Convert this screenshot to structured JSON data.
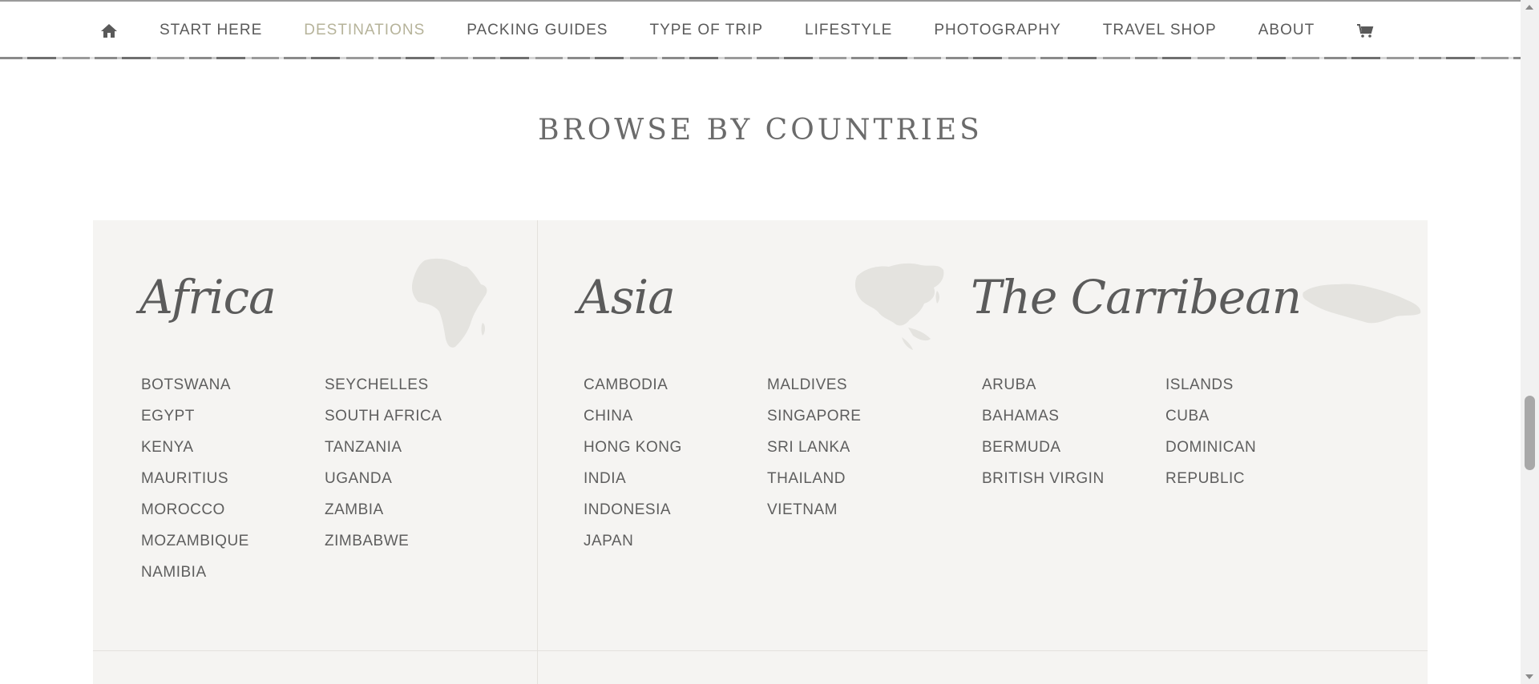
{
  "nav": {
    "items": [
      {
        "label": "START HERE"
      },
      {
        "label": "DESTINATIONS",
        "active": true
      },
      {
        "label": "PACKING GUIDES"
      },
      {
        "label": "TYPE OF TRIP"
      },
      {
        "label": "LIFESTYLE"
      },
      {
        "label": "PHOTOGRAPHY"
      },
      {
        "label": "TRAVEL SHOP"
      },
      {
        "label": "ABOUT"
      }
    ],
    "icons": {
      "home": "home-icon",
      "cart": "cart-icon"
    },
    "active_color": "#b6b39a"
  },
  "section": {
    "title": "BROWSE BY COUNTRIES"
  },
  "regions": {
    "africa": {
      "title": "Africa",
      "col1": [
        "BOTSWANA",
        "EGYPT",
        "KENYA",
        "MAURITIUS",
        "MOROCCO",
        "MOZAMBIQUE",
        "NAMIBIA"
      ],
      "col2": [
        "SEYCHELLES",
        "SOUTH AFRICA",
        "TANZANIA",
        "UGANDA",
        "ZAMBIA",
        "ZIMBABWE"
      ]
    },
    "asia": {
      "title": "Asia",
      "col1": [
        "CAMBODIA",
        "CHINA",
        "HONG KONG",
        "INDIA",
        "INDONESIA",
        "JAPAN"
      ],
      "col2": [
        "MALDIVES",
        "SINGAPORE",
        "SRI LANKA",
        "THAILAND",
        "VIETNAM"
      ]
    },
    "caribbean": {
      "title": "The Carribean",
      "col1": [
        "ARUBA",
        "BAHAMAS",
        "BERMUDA",
        "BRITISH VIRGIN"
      ],
      "col2": [
        "ISLANDS",
        "CUBA",
        "DOMINICAN",
        "REPUBLIC"
      ]
    }
  },
  "colors": {
    "panel_bg": "#f5f4f2",
    "text": "#5e5e5e"
  }
}
